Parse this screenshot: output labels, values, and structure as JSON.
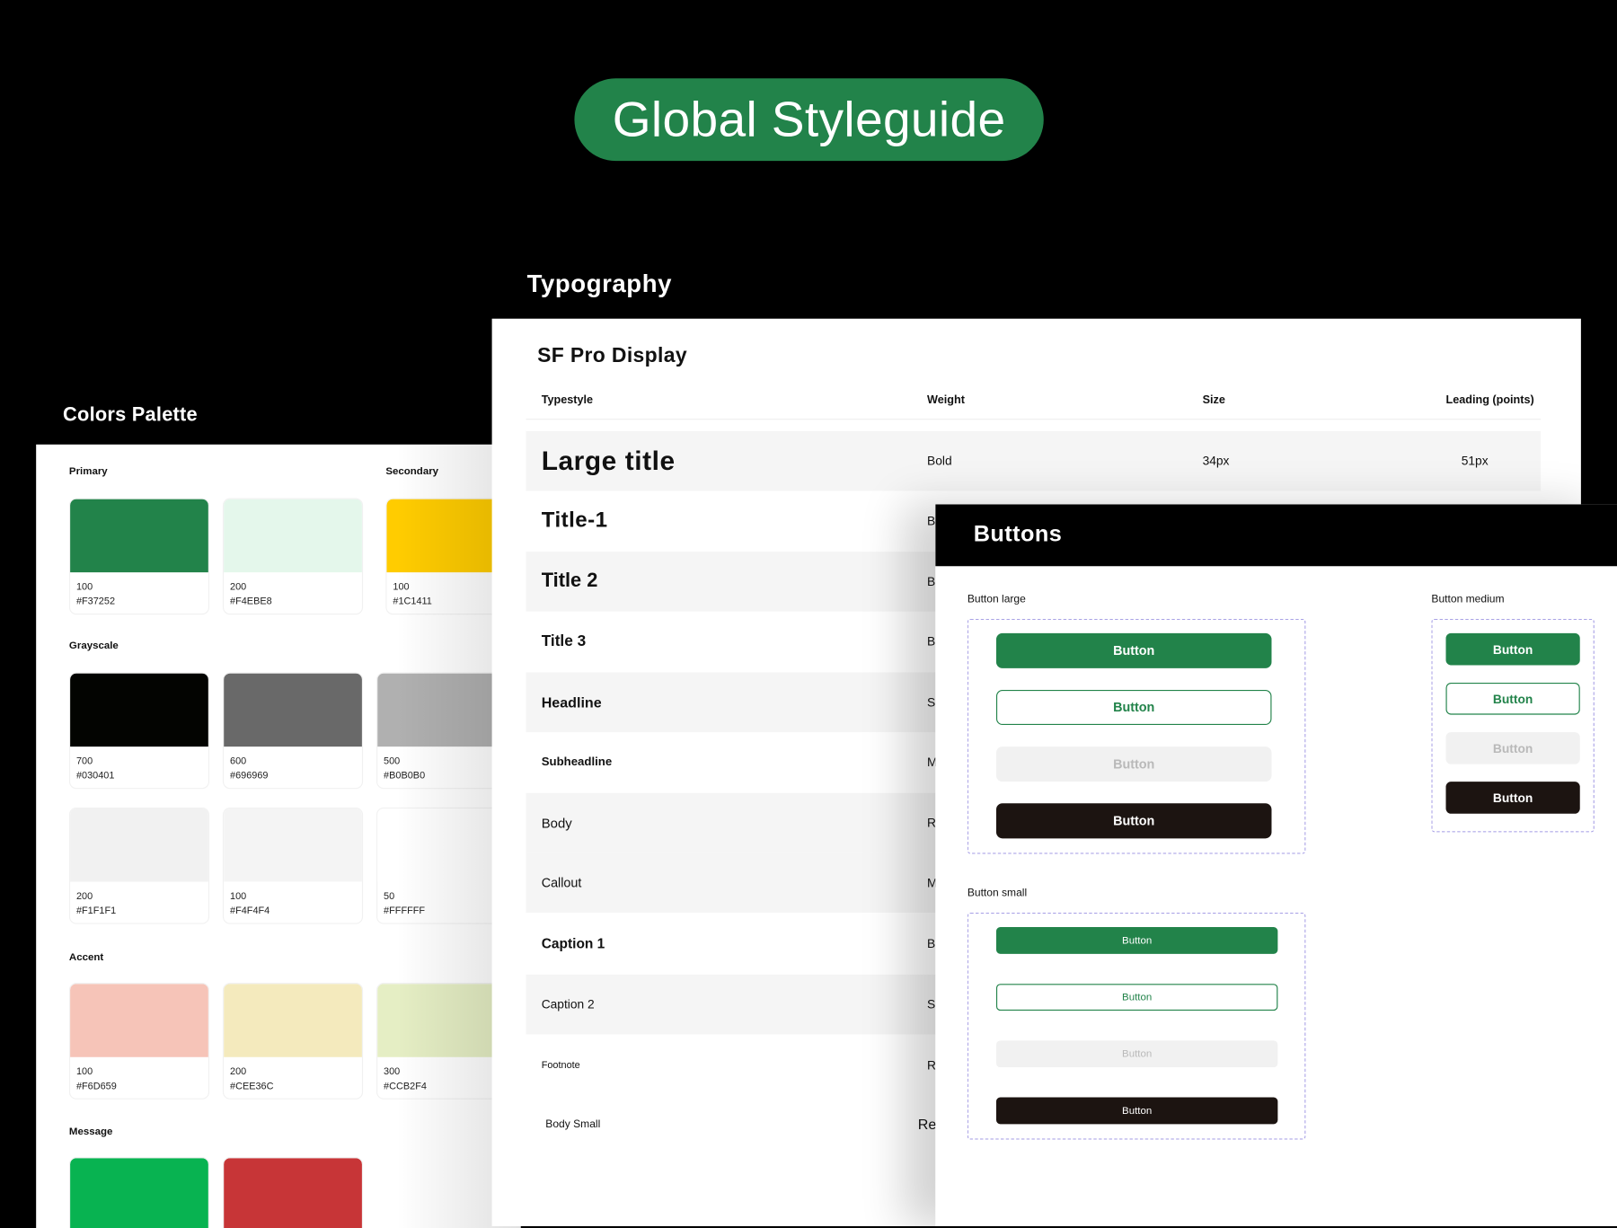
{
  "hero": {
    "title": "Global Styleguide",
    "color": "#22834A"
  },
  "colors": {
    "title": "Colors Palette",
    "groups": {
      "primary": "Primary",
      "secondary": "Secondary",
      "grayscale": "Grayscale",
      "accent": "Accent",
      "message": "Message"
    },
    "swatches": [
      {
        "step": "100",
        "hex": "#F37252",
        "fill": "#22834A"
      },
      {
        "step": "200",
        "hex": "#F4EBE8",
        "fill": "#E4F7EB"
      },
      {
        "step": "100",
        "hex": "#1C1411",
        "fill": "#FFCC00"
      },
      {
        "step": "700",
        "hex": "#030401",
        "fill": "#030401"
      },
      {
        "step": "600",
        "hex": "#696969",
        "fill": "#696969"
      },
      {
        "step": "500",
        "hex": "#B0B0B0",
        "fill": "#B0B0B0"
      },
      {
        "step": "200",
        "hex": "#F1F1F1",
        "fill": "#F1F1F1"
      },
      {
        "step": "100",
        "hex": "#F4F4F4",
        "fill": "#F4F4F4"
      },
      {
        "step": "50",
        "hex": "#FFFFFF",
        "fill": "#FFFFFF"
      },
      {
        "step": "100",
        "hex": "#F6D659",
        "fill": "#F6C4B8"
      },
      {
        "step": "200",
        "hex": "#CEE36C",
        "fill": "#F4EABD"
      },
      {
        "step": "300",
        "hex": "#CCB2F4",
        "fill": "#E5EEC4"
      },
      {
        "step": "",
        "hex": "",
        "fill": "#08B351"
      },
      {
        "step": "",
        "hex": "",
        "fill": "#C73537"
      }
    ]
  },
  "typography": {
    "title": "Typography",
    "font_name": "SF Pro Display",
    "headers": {
      "typestyle": "Typestyle",
      "weight": "Weight",
      "size": "Size",
      "leading": "Leading (points)"
    },
    "rows": [
      {
        "name": "Large title",
        "weight": "Bold",
        "size": "34px",
        "leading": "51px"
      },
      {
        "name": "Title-1",
        "weight": "B"
      },
      {
        "name": "Title 2",
        "weight": "B"
      },
      {
        "name": "Title 3",
        "weight": "B"
      },
      {
        "name": "Headline",
        "weight": "S"
      },
      {
        "name": "Subheadline",
        "weight": "M"
      },
      {
        "name": "Body",
        "weight": "R"
      },
      {
        "name": "Callout",
        "weight": "M"
      },
      {
        "name": "Caption 1",
        "weight": "B"
      },
      {
        "name": "Caption 2",
        "weight": "S"
      },
      {
        "name": "Footnote",
        "weight": "R"
      },
      {
        "name": "Body Small",
        "weight": "Re"
      }
    ]
  },
  "buttons": {
    "title": "Buttons",
    "large_label": "Button large",
    "medium_label": "Button medium",
    "small_label": "Button small",
    "button_text": "Button"
  }
}
